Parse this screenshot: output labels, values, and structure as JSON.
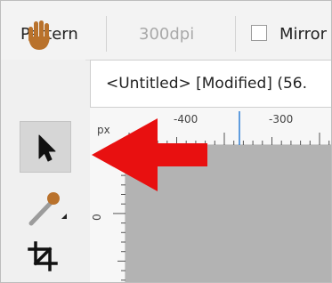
{
  "context_toolbar": {
    "pattern_label": "Pattern",
    "dpi_value": "300dpi",
    "mirror_label": "Mirror"
  },
  "document": {
    "tab_title": "<Untitled> [Modified] (56."
  },
  "rulers": {
    "unit": "px",
    "horizontal_labels": [
      "-400",
      "-300"
    ],
    "vertical_labels": [
      "0"
    ]
  },
  "tools": {
    "items": [
      "hand-tool",
      "move-tool",
      "paint-brush-tool",
      "crop-tool"
    ],
    "selected": "move-tool"
  },
  "annotation": {
    "arrow_color": "#e81010"
  }
}
